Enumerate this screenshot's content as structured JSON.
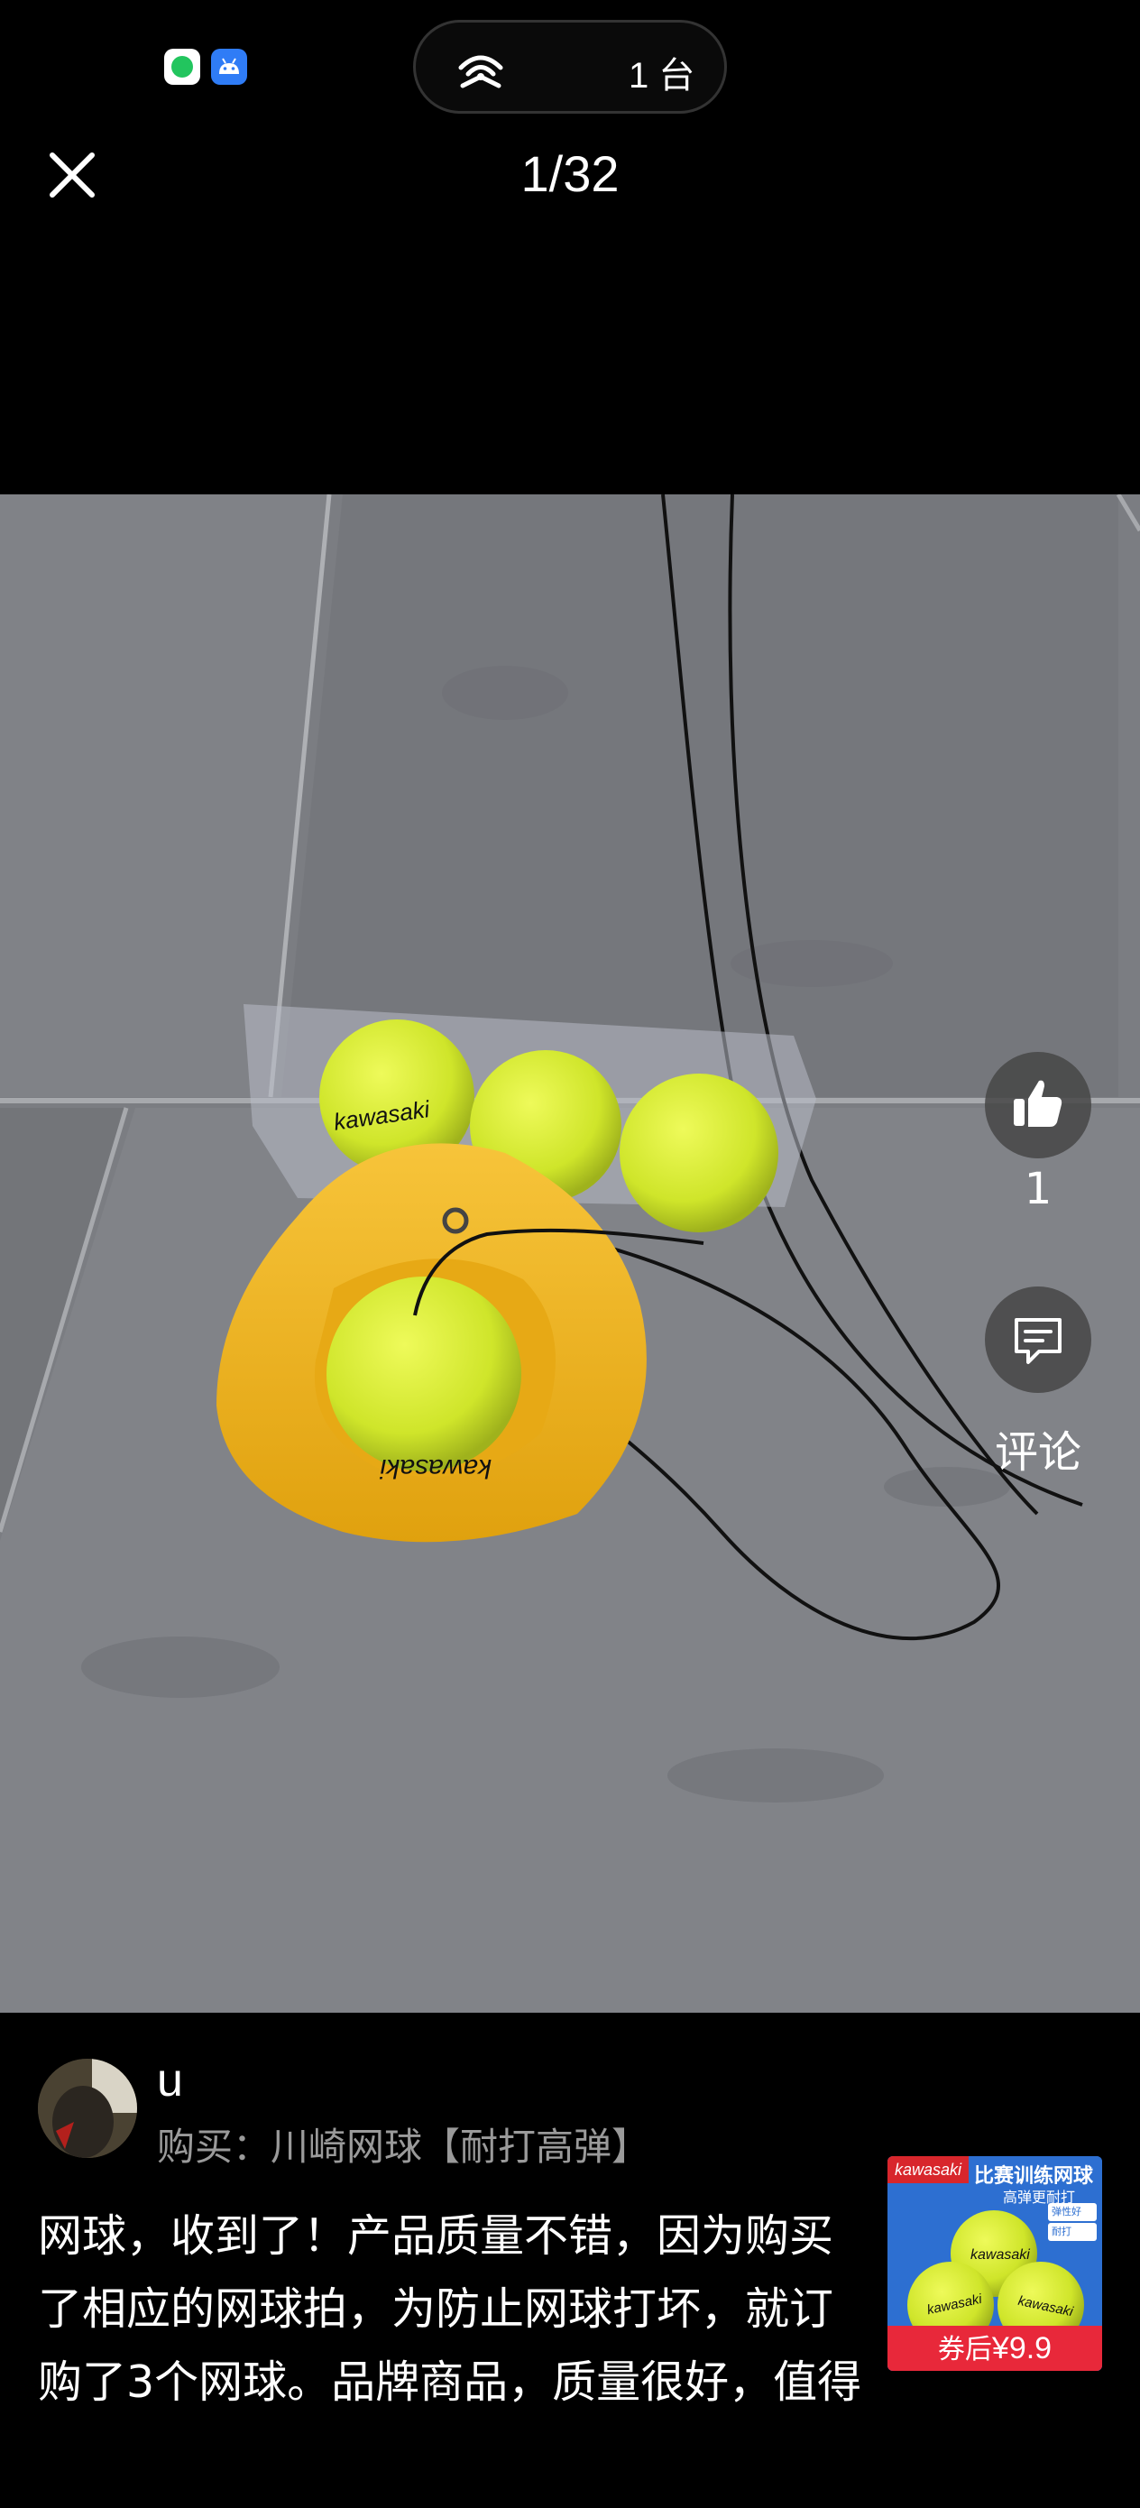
{
  "status_bar": {
    "hotspot_count": "1 台",
    "icons": [
      "spotify-icon",
      "android-icon",
      "hotspot-icon"
    ]
  },
  "header": {
    "close_icon": "close-icon",
    "page_counter": "1/32"
  },
  "side_actions": {
    "like_icon": "thumbs-up-icon",
    "like_count": "1",
    "comment_icon": "comment-icon",
    "comment_label": "评论"
  },
  "review": {
    "username": "u",
    "purchase_label": "购买：川崎网球【耐打高弹】",
    "text": "网球，收到了！产品质量不错，因为购买了相应的网球拍，为防止网球打坏，就订购了3个网球。品牌商品，质量很好，值得信赖！物流快捷，外包装完好"
  },
  "product": {
    "brand": "kawasaki",
    "title": "比赛训练网球",
    "subtitle": "高弹更耐打",
    "tags": [
      "弹性好",
      "耐打"
    ],
    "ball_label": "kawasaki",
    "coupon_label": "券后",
    "price": "¥9.9"
  },
  "colors": {
    "background": "#000000",
    "floor": "#7d7f84",
    "ball": "#d7ef2a",
    "trainer_base": "#f2b41e",
    "price_bar": "#e8283a",
    "product_bg": "#2d6fd1"
  }
}
